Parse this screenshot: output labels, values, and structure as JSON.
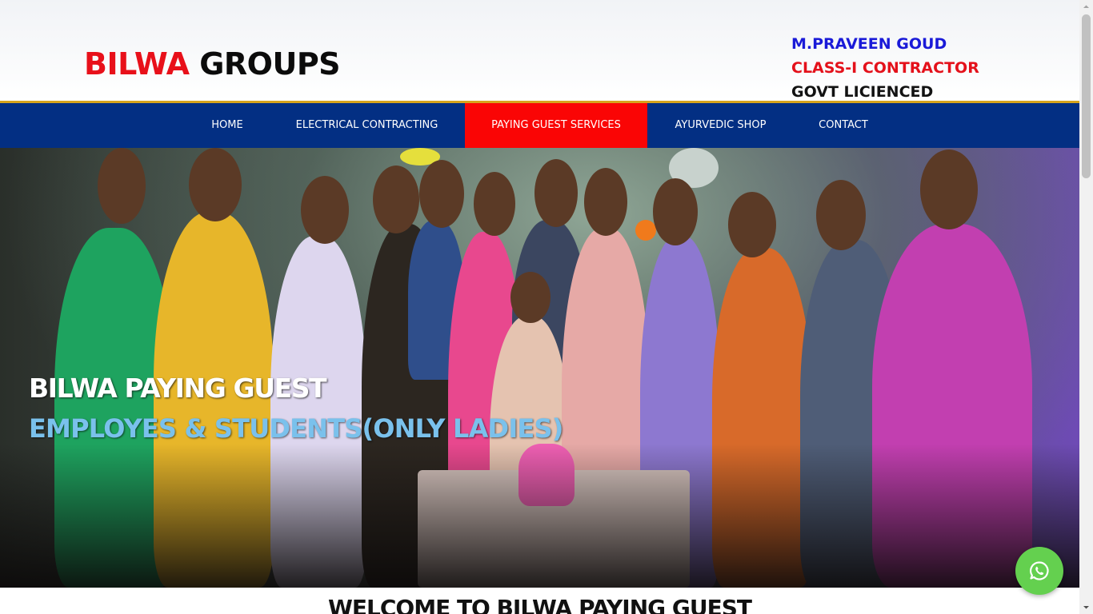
{
  "header": {
    "logo_part1": "BILWA",
    "logo_part2": "GROUPS",
    "owner_name": "M.PRAVEEN GOUD",
    "owner_title": "CLASS-I CONTRACTOR",
    "owner_license": "GOVT LICIENCED"
  },
  "nav": {
    "items": [
      {
        "label": "HOME"
      },
      {
        "label": "ELECTRICAL CONTRACTING"
      },
      {
        "label": "PAYING GUEST SERVICES"
      },
      {
        "label": "AYURVEDIC SHOP"
      },
      {
        "label": "CONTACT"
      }
    ],
    "active_index": 2
  },
  "hero": {
    "title": "BILWA PAYING GUEST",
    "subtitle": "EMPLOYES & STUDENTS(ONLY LADIES)"
  },
  "welcome": {
    "heading": "WELCOME TO BILWA PAYING GUEST"
  },
  "whatsapp": {
    "icon": "whatsapp-icon"
  },
  "colors": {
    "brand_red": "#e8101a",
    "nav_blue": "#032f83",
    "active_red": "#fa0505",
    "gold": "#d7a41d",
    "whatsapp_green": "#64d04f",
    "subtitle_blue": "#7ac1ec"
  }
}
